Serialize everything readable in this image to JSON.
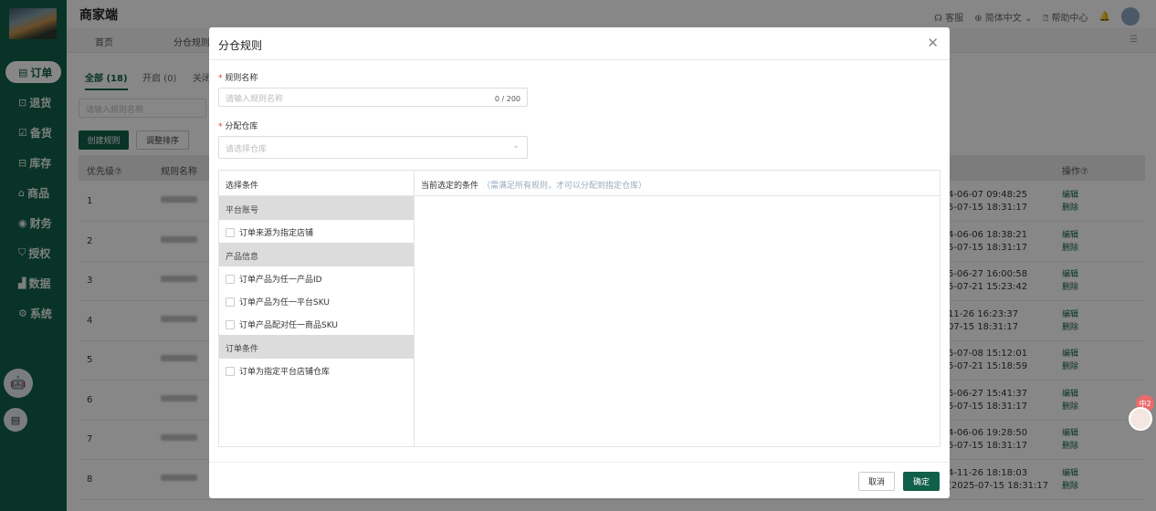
{
  "app": {
    "title": "商家端"
  },
  "header": {
    "service": "客服",
    "language": "简体中文",
    "help": "帮助中心"
  },
  "page_tabs": [
    "首页",
    "分仓规则"
  ],
  "sidebar": {
    "items": [
      {
        "icon": "▤",
        "label": "订单"
      },
      {
        "icon": "⊡",
        "label": "退货"
      },
      {
        "icon": "☑",
        "label": "备货"
      },
      {
        "icon": "⊟",
        "label": "库存"
      },
      {
        "icon": "⌂",
        "label": "商品"
      },
      {
        "icon": "◉",
        "label": "财务"
      },
      {
        "icon": "⛉",
        "label": "授权"
      },
      {
        "icon": "▟",
        "label": "数据"
      },
      {
        "icon": "⚙",
        "label": "系统"
      }
    ]
  },
  "list": {
    "tabs": {
      "all": "全部 (18)",
      "on": "开启 (0)",
      "off": "关闭"
    },
    "search_placeholder": "请输入规则名称",
    "create_button": "创建规则",
    "sort_button": "调整排序",
    "columns": {
      "priority": "优先级⑦",
      "name": "规则名称",
      "ops": "操作⑦"
    },
    "rows": [
      {
        "priority": "1",
        "time1": "4-06-07 09:48:25",
        "time2": "5-07-15 18:31:17"
      },
      {
        "priority": "2",
        "time1": "4-06-06 18:38:21",
        "time2": "5-07-15 18:31:17"
      },
      {
        "priority": "3",
        "time1": "5-06-27 16:00:58",
        "time2": "5-07-21 15:23:42"
      },
      {
        "priority": "4",
        "time1": "11-26 16:23:37",
        "time2": "07-15 18:31:17"
      },
      {
        "priority": "5",
        "time1": "5-07-08 15:12:01",
        "time2": "5-07-21 15:18:59"
      },
      {
        "priority": "6",
        "time1": "5-06-27 15:41:37",
        "time2": "5-07-15 18:31:17"
      },
      {
        "priority": "7",
        "time1": "4-06-06 19:28:50",
        "time2": "5-07-15 18:31:17"
      },
      {
        "priority": "8",
        "time1": "4-11-26 18:18:03",
        "time2": "(2025-07-15 18:31:17"
      }
    ],
    "edit": "编辑",
    "delete": "删除"
  },
  "modal": {
    "title": "分仓规则",
    "name_label": "规则名称",
    "name_placeholder": "请输入规则名称",
    "name_count": "0 / 200",
    "warehouse_label": "分配仓库",
    "warehouse_placeholder": "请选择仓库",
    "select_conditions": "选择条件",
    "current_conditions": "当前选定的条件",
    "current_hint": "（需满足所有规则，才可以分配到指定仓库）",
    "groups": [
      {
        "title": "平台账号",
        "options": [
          "订单来源为指定店铺"
        ]
      },
      {
        "title": "产品信息",
        "options": [
          "订单产品为任一产品ID",
          "订单产品为任一平台SKU",
          "订单产品配对任一商品SKU"
        ]
      },
      {
        "title": "订单条件",
        "options": [
          "订单为指定平台店铺仓库"
        ]
      }
    ],
    "cancel": "取消",
    "ok": "确定"
  },
  "float_badge": "中2"
}
